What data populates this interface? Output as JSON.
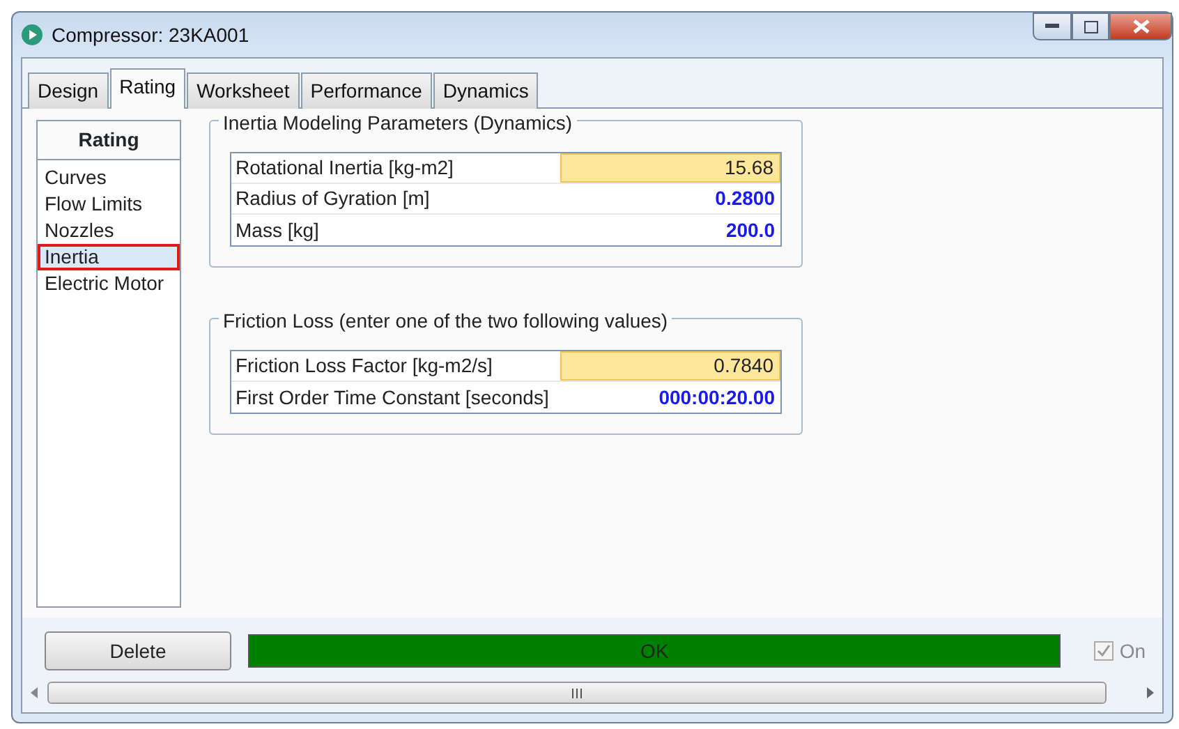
{
  "window": {
    "title": "Compressor: 23KA001"
  },
  "tabs": [
    {
      "label": "Design",
      "selected": false
    },
    {
      "label": "Rating",
      "selected": true
    },
    {
      "label": "Worksheet",
      "selected": false
    },
    {
      "label": "Performance",
      "selected": false
    },
    {
      "label": "Dynamics",
      "selected": false
    }
  ],
  "sidebar": {
    "title": "Rating",
    "items": [
      {
        "label": "Curves",
        "selected": false
      },
      {
        "label": "Flow Limits",
        "selected": false
      },
      {
        "label": "Nozzles",
        "selected": false
      },
      {
        "label": "Inertia",
        "selected": true
      },
      {
        "label": "Electric Motor",
        "selected": false
      }
    ]
  },
  "groups": [
    {
      "title": "Inertia Modeling Parameters (Dynamics)",
      "rows": [
        {
          "label": "Rotational Inertia [kg-m2]",
          "value": "15.68",
          "kind": "input"
        },
        {
          "label": "Radius of Gyration [m]",
          "value": "0.2800",
          "kind": "calculated"
        },
        {
          "label": "Mass [kg]",
          "value": "200.0",
          "kind": "calculated"
        }
      ]
    },
    {
      "title": "Friction Loss (enter one of the two following values)",
      "rows": [
        {
          "label": "Friction Loss Factor [kg-m2/s]",
          "value": "0.7840",
          "kind": "input"
        },
        {
          "label": "First Order Time Constant [seconds]",
          "value": "000:00:20.00",
          "kind": "calculated"
        }
      ]
    }
  ],
  "footer": {
    "delete_button": "Delete",
    "status": "OK",
    "on_checkbox": {
      "label": "On",
      "checked": true,
      "disabled": true
    }
  }
}
